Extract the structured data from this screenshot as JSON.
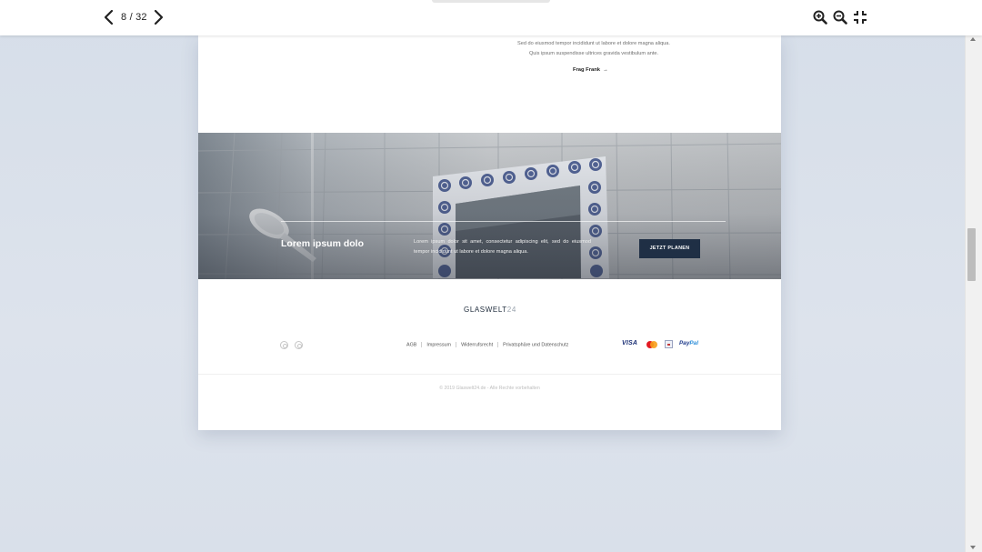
{
  "viewer": {
    "current_page": "8",
    "total_pages": "32",
    "counter_text": "8 / 32",
    "icons": {
      "prev": "chevron-left-icon",
      "next": "chevron-right-icon",
      "zoom_in": "zoom-in-icon",
      "zoom_out": "zoom-out-icon",
      "exit_fullscreen": "exit-fullscreen-icon"
    }
  },
  "page": {
    "intro": {
      "line1": "Sed do eiusmod tempor incididunt ut labore et dolore magna aliqua.",
      "line2": "Quis ipsum suspendisse ultrices gravida vestibulum ante.",
      "link_label": "Frag Frank",
      "link_arrow": "→"
    },
    "banner": {
      "title": "Lorem ipsum dolo",
      "text": "Lorem ipsum dolor sit amet, consectetur adipiscing elit, sed do eiusmod tempor incididunt ut labore et dolore magna aliqua.",
      "button_label": "JETZT PLANEN"
    },
    "footer": {
      "brand_name": "GLASWELT",
      "brand_number": "24",
      "social_icons": [
        "instagram-icon",
        "pinterest-icon"
      ],
      "links": [
        "AGB",
        "Impressum",
        "Widerrufsrecht",
        "Privatsphäre und Datenschutz"
      ],
      "payments": {
        "visa": "VISA",
        "paypal_pay": "Pay",
        "paypal_pal": "Pal"
      },
      "copyright": "© 2019 Glaswelt24.de - Alle Rechte vorbehalten"
    }
  },
  "colors": {
    "background": "#d9e0ea",
    "navy_button": "#1f2f45",
    "brand_text": "#1d2a3a",
    "tile_blue": "#3b4f8a"
  }
}
